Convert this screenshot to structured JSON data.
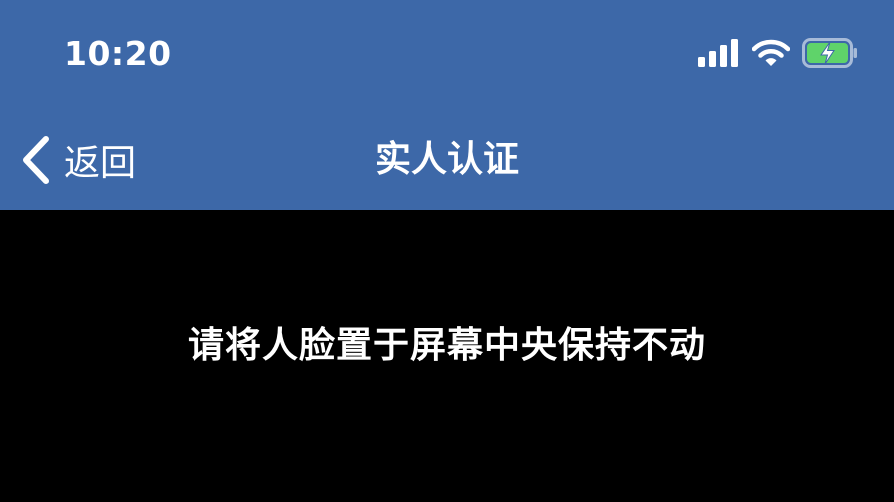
{
  "status_bar": {
    "time": "10:20",
    "icons": [
      "signal-icon",
      "wifi-icon",
      "battery-charging-icon"
    ]
  },
  "nav": {
    "back_label": "返回",
    "title": "实人认证"
  },
  "camera": {
    "instruction": "请将人脸置于屏幕中央保持不动"
  },
  "colors": {
    "header_bg": "#3d68a8",
    "camera_bg": "#000000",
    "battery_green": "#5fd36a"
  }
}
